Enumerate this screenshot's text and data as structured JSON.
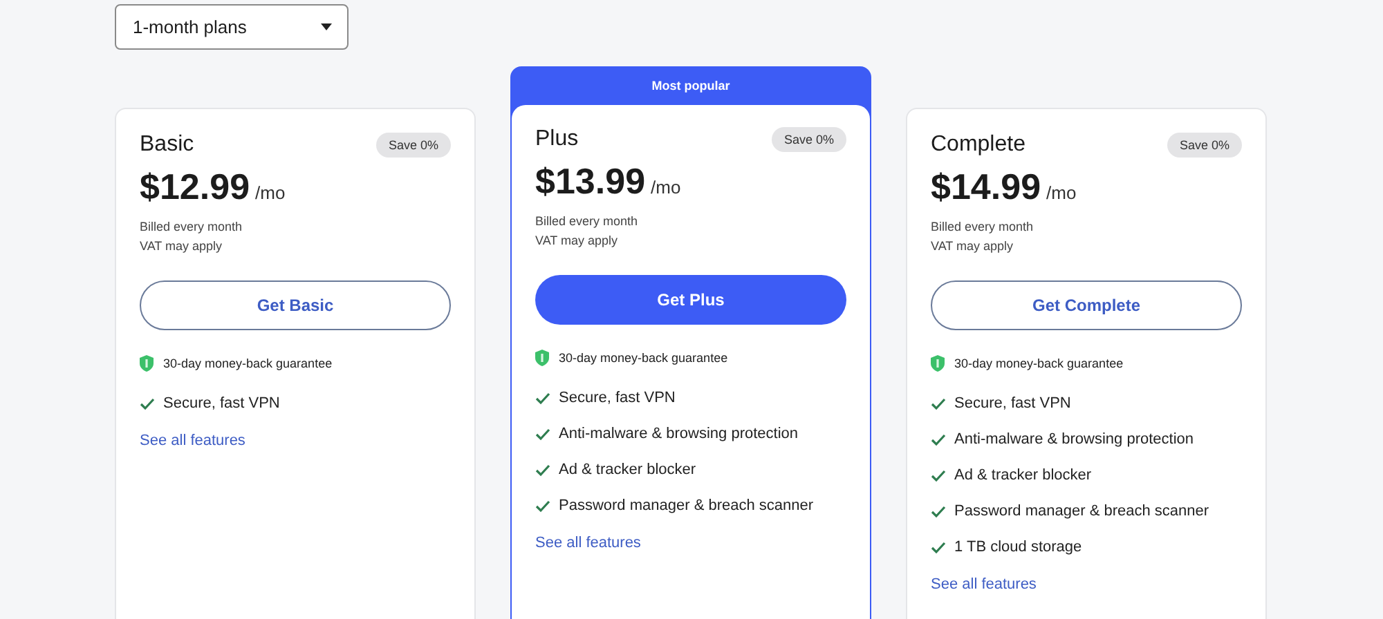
{
  "plan_length_select": {
    "value": "1-month plans"
  },
  "plans": [
    {
      "name": "Basic",
      "save": "Save 0%",
      "price": "$12.99",
      "period": "/mo",
      "billed": "Billed every month",
      "vat": "VAT may apply",
      "button": "Get Basic",
      "featured": false,
      "guarantee": "30-day money-back guarantee",
      "features": [
        "Secure, fast VPN"
      ],
      "link": "See all features"
    },
    {
      "name": "Plus",
      "badge": "Most popular",
      "save": "Save 0%",
      "price": "$13.99",
      "period": "/mo",
      "billed": "Billed every month",
      "vat": "VAT may apply",
      "button": "Get Plus",
      "featured": true,
      "guarantee": "30-day money-back guarantee",
      "features": [
        "Secure, fast VPN",
        "Anti-malware & browsing protection",
        "Ad & tracker blocker",
        "Password manager & breach scanner"
      ],
      "link": "See all features"
    },
    {
      "name": "Complete",
      "save": "Save 0%",
      "price": "$14.99",
      "period": "/mo",
      "billed": "Billed every month",
      "vat": "VAT may apply",
      "button": "Get Complete",
      "featured": false,
      "guarantee": "30-day money-back guarantee",
      "features": [
        "Secure, fast VPN",
        "Anti-malware & browsing protection",
        "Ad & tracker blocker",
        "Password manager & breach scanner",
        "1 TB cloud storage"
      ],
      "link": "See all features"
    }
  ]
}
